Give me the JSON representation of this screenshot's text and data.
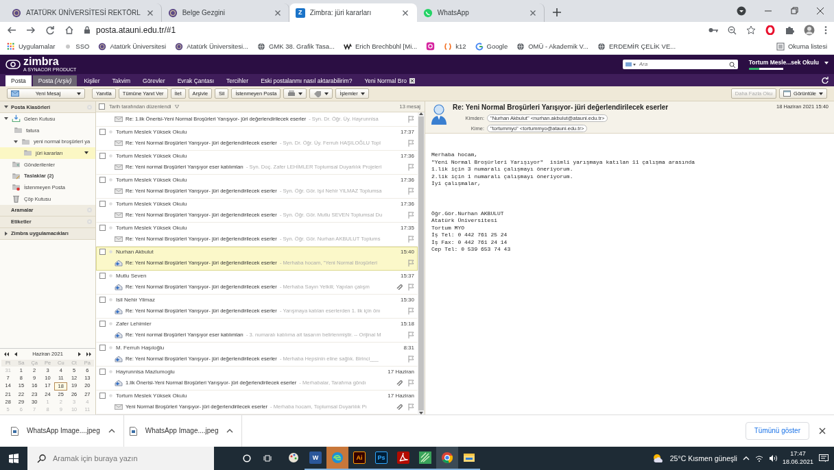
{
  "browser": {
    "tabs": [
      {
        "title": "ATATÜRK ÜNİVERSİTESİ REKTÖRL",
        "kind": "seal",
        "selected": false
      },
      {
        "title": "Belge Gezgini",
        "kind": "seal",
        "selected": false
      },
      {
        "title": "Zimbra: jüri kararları",
        "kind": "letter",
        "icon_letter": "Z",
        "selected": true
      },
      {
        "title": "WhatsApp",
        "kind": "whatsapp",
        "selected": false
      }
    ],
    "address": "posta.atauni.edu.tr/#1",
    "bookmarks": [
      {
        "label": "Uygulamalar",
        "kind": "apps"
      },
      {
        "label": "SSO",
        "kind": "dot"
      },
      {
        "label": "Atatürk Üniversitesi",
        "kind": "seal"
      },
      {
        "label": "Atatürk Üniversitesi...",
        "kind": "seal"
      },
      {
        "label": "GMK 38. Grafik Tasa...",
        "kind": "globe"
      },
      {
        "label": "Erich Brechbühl [Mi...",
        "kind": "zigzag"
      },
      {
        "kind": "instagram"
      },
      {
        "label": "k12",
        "kind": "k12"
      },
      {
        "label": "Google",
        "kind": "google"
      },
      {
        "label": "OMÜ - Akademik V...",
        "kind": "globe"
      },
      {
        "label": "ERDEMİR ÇELİK VE...",
        "kind": "globe"
      }
    ],
    "reading_list": "Okuma listesi"
  },
  "zimbra": {
    "logo": "zimbra",
    "tagline": "A SYNACOR PRODUCT",
    "search_placeholder": "Ara",
    "user": "Tortum Mesle...sek Okulu",
    "quota": {
      "level": 0.3
    },
    "app_tabs": [
      {
        "label": "Posta",
        "selected": true
      },
      {
        "label": "Posta *(Arşiv)*",
        "selected": false
      },
      {
        "label": "Kişiler",
        "selected": false
      },
      {
        "label": "Takvim",
        "selected": false
      },
      {
        "label": "Görevler",
        "selected": false
      },
      {
        "label": "Evrak Çantası",
        "selected": false
      },
      {
        "label": "Tercihler",
        "selected": false
      },
      {
        "label": "Eski postalanmı nasıl aktarabilirim?",
        "selected": false
      },
      {
        "label": "Yeni Normal Bro",
        "selected": false,
        "closable": true
      }
    ],
    "toolbar": [
      {
        "kind": "new",
        "label": "Yeni Mesaj"
      },
      {
        "kind": "plain",
        "label": "Yanıtla"
      },
      {
        "kind": "plain",
        "label": "Tümüne Yanıt Ver"
      },
      {
        "kind": "plain",
        "label": "İlet"
      },
      {
        "kind": "plain",
        "label": "Arşivle"
      },
      {
        "kind": "plain",
        "label": "Sil"
      },
      {
        "kind": "plain",
        "label": "İstenmeyen Posta"
      },
      {
        "kind": "print"
      },
      {
        "kind": "tag"
      },
      {
        "kind": "menu",
        "label": "İşlemler"
      }
    ],
    "toolbar_right": [
      {
        "kind": "plain",
        "label": "Daha Fazla Oku",
        "disabled": true
      },
      {
        "kind": "view",
        "label": "Görüntüle",
        "disabled": false
      }
    ]
  },
  "sidebar": {
    "sections": [
      {
        "title": "Posta Klasörleri",
        "kind": "collapsible",
        "expanded": true,
        "folders": [
          {
            "label": "Gelen Kutusu",
            "kind": "inbox",
            "expanded": true,
            "selected": false,
            "unread": false,
            "children": [
              {
                "label": "fatura",
                "kind": "folder",
                "selected": false,
                "unread": false
              },
              {
                "label": "yeni normal broşürleri ya",
                "kind": "folder",
                "expanded": true,
                "selected": false,
                "unread": false,
                "children": [
                  {
                    "label": "jüri kararları",
                    "kind": "folder",
                    "selected": true,
                    "unread": false
                  }
                ]
              }
            ]
          },
          {
            "label": "Gönderilenler",
            "kind": "sent",
            "selected": false,
            "unread": false
          },
          {
            "label": "Taslaklar (2)",
            "kind": "drafts",
            "selected": false,
            "unread": true
          },
          {
            "label": "İstenmeyen Posta",
            "kind": "junk",
            "selected": false,
            "unread": false
          },
          {
            "label": "Çöp Kutusu",
            "kind": "trash",
            "selected": false,
            "unread": false
          }
        ]
      },
      {
        "title": "Aramalar",
        "kind": "plain"
      },
      {
        "title": "Etiketler",
        "kind": "plain"
      },
      {
        "title": "Zimbra uygulamacıkları",
        "kind": "collapsible",
        "expanded": false
      }
    ],
    "calendar": {
      "month": "Haziran 2021",
      "weekdays": [
        "Pt",
        "Sa",
        "Ça",
        "Pe",
        "Cu",
        "Ct",
        "Pa"
      ],
      "weeks": [
        [
          {
            "day": "31",
            "outside": true,
            "selected": false
          },
          {
            "day": "1",
            "outside": false,
            "selected": false
          },
          {
            "day": "2",
            "outside": false,
            "selected": false
          },
          {
            "day": "3",
            "outside": false,
            "selected": false
          },
          {
            "day": "4",
            "outside": false,
            "selected": false
          },
          {
            "day": "5",
            "outside": false,
            "selected": false
          },
          {
            "day": "6",
            "outside": false,
            "selected": false
          }
        ],
        [
          {
            "day": "7",
            "outside": false,
            "selected": false
          },
          {
            "day": "8",
            "outside": false,
            "selected": false
          },
          {
            "day": "9",
            "outside": false,
            "selected": false
          },
          {
            "day": "10",
            "outside": false,
            "selected": false
          },
          {
            "day": "11",
            "outside": false,
            "selected": false
          },
          {
            "day": "12",
            "outside": false,
            "selected": false
          },
          {
            "day": "13",
            "outside": false,
            "selected": false
          }
        ],
        [
          {
            "day": "14",
            "outside": false,
            "selected": false
          },
          {
            "day": "15",
            "outside": false,
            "selected": false
          },
          {
            "day": "16",
            "outside": false,
            "selected": false
          },
          {
            "day": "17",
            "outside": false,
            "selected": false
          },
          {
            "day": "18",
            "outside": false,
            "selected": true
          },
          {
            "day": "19",
            "outside": false,
            "selected": false
          },
          {
            "day": "20",
            "outside": false,
            "selected": false
          }
        ],
        [
          {
            "day": "21",
            "outside": false,
            "selected": false
          },
          {
            "day": "22",
            "outside": false,
            "selected": false
          },
          {
            "day": "23",
            "outside": false,
            "selected": false
          },
          {
            "day": "24",
            "outside": false,
            "selected": false
          },
          {
            "day": "25",
            "outside": false,
            "selected": false
          },
          {
            "day": "26",
            "outside": false,
            "selected": false
          },
          {
            "day": "27",
            "outside": false,
            "selected": false
          }
        ],
        [
          {
            "day": "28",
            "outside": false,
            "selected": false
          },
          {
            "day": "29",
            "outside": false,
            "selected": false
          },
          {
            "day": "30",
            "outside": false,
            "selected": false
          },
          {
            "day": "1",
            "outside": true,
            "selected": false
          },
          {
            "day": "2",
            "outside": true,
            "selected": false
          },
          {
            "day": "3",
            "outside": true,
            "selected": false
          },
          {
            "day": "4",
            "outside": true,
            "selected": false
          }
        ],
        [
          {
            "day": "5",
            "outside": true,
            "selected": false
          },
          {
            "day": "6",
            "outside": true,
            "selected": false
          },
          {
            "day": "7",
            "outside": true,
            "selected": false
          },
          {
            "day": "8",
            "outside": true,
            "selected": false
          },
          {
            "day": "9",
            "outside": true,
            "selected": false
          },
          {
            "day": "10",
            "outside": true,
            "selected": false
          },
          {
            "day": "11",
            "outside": true,
            "selected": false
          }
        ]
      ]
    }
  },
  "message_list": {
    "all_checked": false,
    "sort_label": "Tarih tarafından düzenlendi",
    "count": "13 mesaj",
    "messages": [
      {
        "subject": "Re: 1.lik Önerisi-Yeni Normal Broşürleri Yarışıyor- jüri değerlendirilecek eserler",
        "fragment": "- Syn. Dr. Öğr. Üy. Hayrunnisa",
        "replied": false,
        "attachment": false,
        "selected": false
      },
      {
        "sender": "Tortum Meslek Yüksek Okulu",
        "time": "17:37",
        "subject": "Re: Yeni Normal Broşürleri Yarışıyor- jüri değerlendirilecek eserler",
        "fragment": "- Syn. Dr. Öğr. Üy. Ferruh HAŞILOĞLU Topl",
        "checked": false,
        "replied": false,
        "attachment": false,
        "selected": false
      },
      {
        "sender": "Tortum Meslek Yüksek Okulu",
        "time": "17:36",
        "subject": "Re: Yeni normal Broşürleri Yarışıyor eser katılımları",
        "fragment": "- Syn. Doç. Zafer LEHİMLER Toplumsal Duyarlılık Projeleri",
        "checked": false,
        "replied": false,
        "attachment": false,
        "selected": false
      },
      {
        "sender": "Tortum Meslek Yüksek Okulu",
        "time": "17:36",
        "subject": "Re: Yeni Normal Broşürleri Yarışıyor- jüri değerlendirilecek eserler",
        "fragment": "- Syn. Öğr. Gör. Işıl Nehir YILMAZ Toplumsa",
        "checked": false,
        "replied": false,
        "attachment": false,
        "selected": false
      },
      {
        "sender": "Tortum Meslek Yüksek Okulu",
        "time": "17:36",
        "subject": "Re: Yeni Normal Broşürleri Yarışıyor- jüri değerlendirilecek eserler",
        "fragment": "- Syn. Öğr. Gör. Mutlu SEVEN Toplumsal Du",
        "checked": false,
        "replied": false,
        "attachment": false,
        "selected": false
      },
      {
        "sender": "Tortum Meslek Yüksek Okulu",
        "time": "17:35",
        "subject": "Re: Yeni Normal Broşürleri Yarışıyor- jüri değerlendirilecek eserler",
        "fragment": "- Syn. Öğr. Gör. Nurhan AKBULUT Toplums",
        "checked": false,
        "replied": false,
        "attachment": false,
        "selected": false
      },
      {
        "sender": "Nurhan Akbulut",
        "time": "15:40",
        "subject": "Re: Yeni Normal Broşürleri Yarışıyor- jüri değerlendirilecek eserler",
        "fragment": "- Merhaba hocam, \"Yeni Normal Broşürleri",
        "checked": false,
        "replied": true,
        "attachment": false,
        "selected": true
      },
      {
        "sender": "Mutlu Seven",
        "time": "15:37",
        "subject": "Re: Yeni Normal Broşürleri Yarışıyor- jüri değerlendirilecek eserler",
        "fragment": "- Merhaba Sayın Yetkili; Yapılan çalışm",
        "checked": false,
        "replied": true,
        "attachment": true,
        "selected": false
      },
      {
        "sender": "Isil Nehir Yilmaz",
        "time": "15:30",
        "subject": "Re: Yeni Normal Broşürleri Yarışıyor- jüri değerlendirilecek eserler",
        "fragment": "- Yarışmaya katılan eserlerden 1. lik için önı",
        "checked": false,
        "replied": true,
        "attachment": false,
        "selected": false
      },
      {
        "sender": "Zafer Lehimler",
        "time": "15:18",
        "subject": "Re: Yeni normal Broşürleri Yarışıyor eser katılımları",
        "fragment": "- 3. numaralı katılıma ait tasarım belirlenmiştir. -- Orijinal M",
        "checked": false,
        "replied": true,
        "attachment": false,
        "selected": false
      },
      {
        "sender": "M. Ferruh Haşıloğlu",
        "time": "8:31",
        "subject": "Re: Yeni Normal Broşürleri Yarışıyor- jüri değerlendirilecek eserler",
        "fragment": "- Merhaba Hepsinin eline sağlık. Birinci___",
        "checked": false,
        "replied": true,
        "attachment": false,
        "selected": false
      },
      {
        "sender": "Hayrunnisa Mazlumoglu",
        "time": "17 Haziran",
        "subject": "1.lik Önerisi-Yeni Normal Broşürleri Yarışıyor- jüri değerlendirilecek eserler",
        "fragment": "- Merhabalar, Tarafıma göndı",
        "checked": false,
        "replied": true,
        "attachment": true,
        "selected": false
      },
      {
        "sender": "Tortum Meslek Yüksek Okulu",
        "time": "17 Haziran",
        "subject": "Yeni Normal Broşürleri Yarışıyor- jüri değerlendirilecek eserler",
        "fragment": "- Merhaba hocam, Toplumsal Duyarlılık Pı",
        "checked": false,
        "replied": false,
        "attachment": true,
        "selected": false
      }
    ]
  },
  "reading_pane": {
    "subject": "Re: Yeni Normal Broşürleri Yarışıyor- jüri değerlendirilecek eserler",
    "date": "18 Haziran 2021 15:40",
    "from_label": "Kimden:",
    "from": "\"Nurhan Akbulut\" <nurhan.akbulut@atauni.edu.tr>",
    "to_label": "Kime:",
    "to": "\"tortummyo\" <tortummyo@atauni.edu.tr>",
    "body": [
      "Merhaba hocam,",
      "\"Yeni Normal Broşürleri Yarışıyor\"  isimli yarışmaya katılan 11 çalışma arasında",
      "1.lik için 3 numaralı çalışmayı öneriyorum.",
      "2.lik için 1 numaralı çalışmayı öneriyorum.",
      "İyi çalışmalar,"
    ],
    "signature": [
      "Öğr.Gör.Nurhan AKBULUT",
      "Atatürk Üniversitesi",
      "Tortum MYO",
      "İş Tel: 0 442 761 25 24",
      "İş Fax: 0 442 761 24 14",
      "Cep Tel: 0 539 653 74 43"
    ]
  },
  "downloads": {
    "files": [
      {
        "name": "WhatsApp Image....jpeg"
      },
      {
        "name": "WhatsApp Image....jpeg"
      }
    ],
    "show_all": "Tümünü göster"
  },
  "taskbar": {
    "search_placeholder": "Aramak için buraya yazın",
    "apps": [
      {
        "kind": "paint",
        "running": false,
        "active": false
      },
      {
        "kind": "word",
        "label": "W",
        "running": true,
        "active": false
      },
      {
        "kind": "edge",
        "running": true,
        "active": false,
        "flashing": true
      },
      {
        "kind": "illustrator",
        "label": "Ai",
        "running": true,
        "active": false
      },
      {
        "kind": "photoshop",
        "label": "Ps",
        "running": true,
        "active": false
      },
      {
        "kind": "acrobat",
        "running": true,
        "active": false
      },
      {
        "kind": "sketch",
        "running": true,
        "active": false
      },
      {
        "kind": "chrome",
        "running": true,
        "active": true
      },
      {
        "kind": "explorer",
        "running": true,
        "active": false
      }
    ],
    "weather": "25°C Kısmen güneşli",
    "time": "17:47",
    "date": "18.06.2021"
  }
}
